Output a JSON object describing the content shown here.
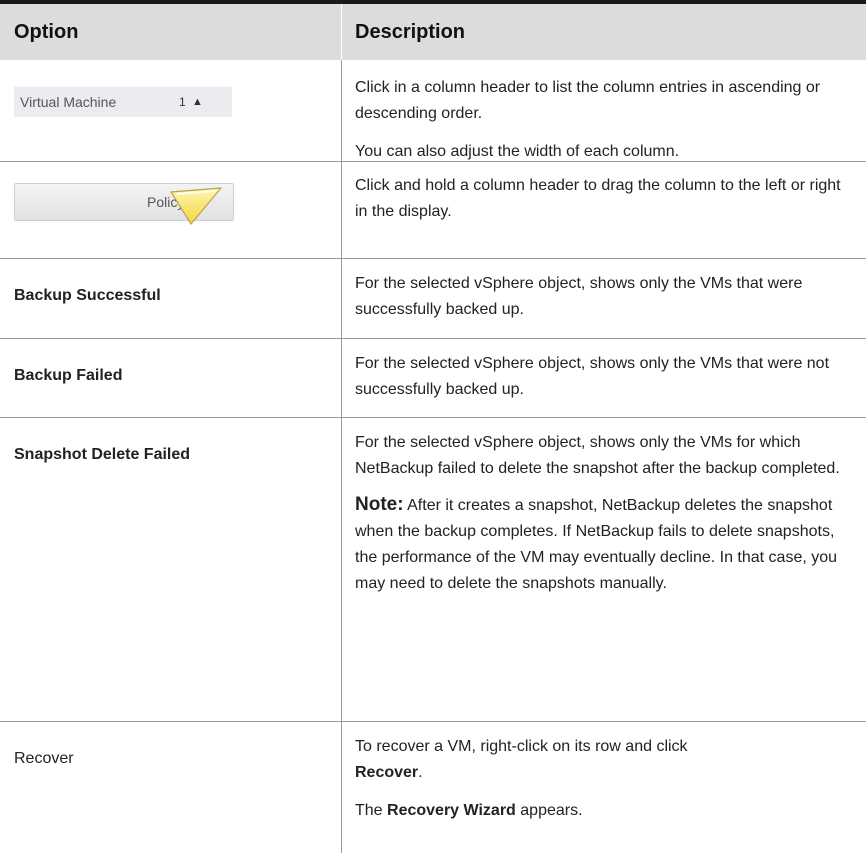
{
  "header": {
    "option": "Option",
    "description": "Description"
  },
  "rows": [
    {
      "option_widget": {
        "label": "Virtual Machine",
        "sort_index": "1",
        "sort_arrow": "▲"
      },
      "description": [
        "Click in a column header to list the column entries in ascending or descending order.",
        "You can also adjust the width of each column."
      ]
    },
    {
      "option_widget": {
        "label": "Policy"
      },
      "description": [
        "Click and hold a column header to drag the column to the left or right in the display."
      ]
    },
    {
      "option": "Backup Successful",
      "description": [
        "For the selected vSphere object, shows only the VMs that were successfully backed up."
      ]
    },
    {
      "option": "Backup Failed",
      "description": [
        "For the selected vSphere object, shows only the VMs that were not successfully backed up."
      ]
    },
    {
      "option": "Snapshot Delete Failed",
      "description": [
        "For the selected vSphere object, shows only the VMs for which NetBackup failed to delete the snapshot after the backup completed."
      ],
      "note_label": "Note:",
      "note_text": "After it creates a snapshot, NetBackup deletes the snapshot when the backup completes. If NetBackup fails to delete snapshots, the performance of the VM may eventually decline. In that case, you may need to delete the snapshots manually."
    },
    {
      "option": "Recover",
      "desc_part1": "To recover a VM, right-click on its row and click",
      "desc_bold1": "Recover",
      "desc_period": ".",
      "desc2_pre": "The",
      "desc2_bold": "Recovery Wizard",
      "desc2_post": "appears."
    }
  ]
}
